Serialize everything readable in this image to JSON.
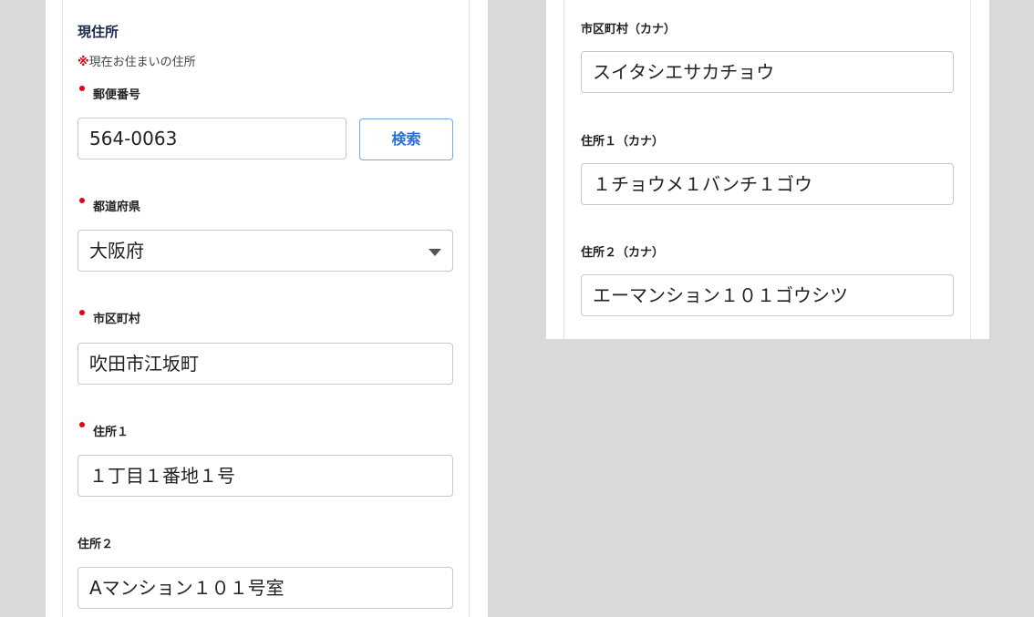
{
  "current_address": {
    "title": "現住所",
    "note_mark": "※",
    "note_text": "現在お住まいの住所",
    "postal_code": {
      "label": "郵便番号",
      "value": "564-0063",
      "required": true
    },
    "search_button_label": "検索",
    "prefecture": {
      "label": "都道府県",
      "value": "大阪府",
      "required": true
    },
    "city": {
      "label": "市区町村",
      "value": "吹田市江坂町",
      "required": true
    },
    "address1": {
      "label": "住所１",
      "value": "１丁目１番地１号",
      "required": true
    },
    "address2": {
      "label": "住所２",
      "value": "Aマンション１０１号室",
      "required": false
    }
  },
  "kana": {
    "city_kana": {
      "label": "市区町村（カナ）",
      "value": "スイタシエサカチョウ"
    },
    "address1_kana": {
      "label": "住所１（カナ）",
      "value": "１チョウメ１バンチ１ゴウ"
    },
    "address2_kana": {
      "label": "住所２（カナ）",
      "value": "エーマンション１０１ゴウシツ"
    }
  },
  "colors": {
    "required_dot": "#e60012",
    "button_text": "#2a6fd6",
    "background": "#d9d9d9"
  }
}
